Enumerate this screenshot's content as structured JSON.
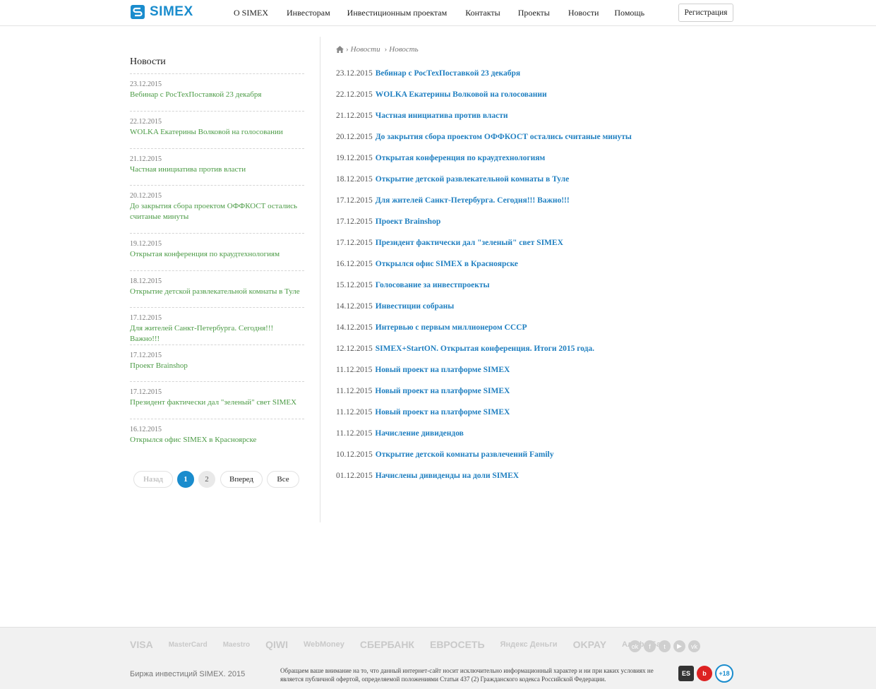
{
  "header": {
    "logo_text": "SIMEX",
    "nav": [
      "О SIMEX",
      "Инвесторам",
      "Инвестиционным проектам",
      "Контакты",
      "Проекты",
      "Новости",
      "Помощь"
    ],
    "register_label": "Регистрация"
  },
  "sidebar": {
    "title": "Новости",
    "items": [
      {
        "date": "23.12.2015",
        "title": "Вебинар с РосТехПоставкой 23 декабря"
      },
      {
        "date": "22.12.2015",
        "title": "WOLKA Екатерины Волковой на голосовании"
      },
      {
        "date": "21.12.2015",
        "title": "Частная инициатива против власти"
      },
      {
        "date": "20.12.2015",
        "title": "До закрытия сбора проектом ОФФКОСТ остались считаные минуты"
      },
      {
        "date": "19.12.2015",
        "title": "Открытая конференция по краудтехнологиям"
      },
      {
        "date": "18.12.2015",
        "title": "Открытие детской развлекательной комнаты в Туле"
      },
      {
        "date": "17.12.2015",
        "title": "Для жителей Санкт-Петербурга. Сегодня!!! Важно!!!"
      },
      {
        "date": "17.12.2015",
        "title": "Проект Brainshop"
      },
      {
        "date": "17.12.2015",
        "title": "Президент фактически дал \"зеленый\" свет SIMEX"
      },
      {
        "date": "16.12.2015",
        "title": "Открылся офис SIMEX в Красноярске"
      }
    ],
    "pagination": {
      "prev": "Назад",
      "page1": "1",
      "page2": "2",
      "next": "Вперед",
      "all": "Все"
    }
  },
  "breadcrumb": [
    "Новости",
    "Новость"
  ],
  "news": [
    {
      "date": "23.12.2015",
      "title": "Вебинар с РосТехПоставкой 23 декабря"
    },
    {
      "date": "22.12.2015",
      "title": "WOLKA Екатерины Волковой на голосовании"
    },
    {
      "date": "21.12.2015",
      "title": "Частная инициатива против власти"
    },
    {
      "date": "20.12.2015",
      "title": "До закрытия сбора проектом ОФФКОСТ остались считаные минуты"
    },
    {
      "date": "19.12.2015",
      "title": "Открытая конференция по краудтехнологиям"
    },
    {
      "date": "18.12.2015",
      "title": "Открытие детской развлекательной комнаты в Туле"
    },
    {
      "date": "17.12.2015",
      "title": "Для жителей Санкт-Петербурга. Сегодня!!! Важно!!!"
    },
    {
      "date": "17.12.2015",
      "title": "Проект Brainshop"
    },
    {
      "date": "17.12.2015",
      "title": "Президент фактически дал \"зеленый\" свет SIMEX"
    },
    {
      "date": "16.12.2015",
      "title": "Открылся офис SIMEX в Красноярске"
    },
    {
      "date": "15.12.2015",
      "title": "Голосование за инвестпроекты"
    },
    {
      "date": "14.12.2015",
      "title": "Инвестиции собраны"
    },
    {
      "date": "14.12.2015",
      "title": "Интервью с первым миллионером СССР"
    },
    {
      "date": "12.12.2015",
      "title": "SIMEX+StartON. Открытая конференция. Итоги 2015 года."
    },
    {
      "date": "11.12.2015",
      "title": "Новый проект на платформе SIMEX"
    },
    {
      "date": "11.12.2015",
      "title": "Новый проект на платформе SIMEX"
    },
    {
      "date": "11.12.2015",
      "title": "Новый проект на платформе SIMEX"
    },
    {
      "date": "11.12.2015",
      "title": "Начисление дивидендов"
    },
    {
      "date": "10.12.2015",
      "title": "Открытие детской комнаты развлечений Family"
    },
    {
      "date": "01.12.2015",
      "title": "Начислены дивиденды на доли SIMEX"
    }
  ],
  "footer": {
    "payment_logos": [
      "VISA",
      "MasterCard",
      "Maestro",
      "QIWI",
      "WebMoney",
      "СБЕРБАНК",
      "ЕВРОСЕТЬ",
      "Яндекс Деньги",
      "OKPAY",
      "Альфа-Банк"
    ],
    "copyright": "Биржа инвестиций SIMEX. 2015",
    "disclaimer": "Обращаем ваше внимание на то, что данный интернет-сайт носит исключительно информационный характер и ни при каких условиях не является публичной офертой, определяемой положениями Статьи 437 (2) Гражданского кодекса Российской Федерации.",
    "age_badge": "+18"
  }
}
